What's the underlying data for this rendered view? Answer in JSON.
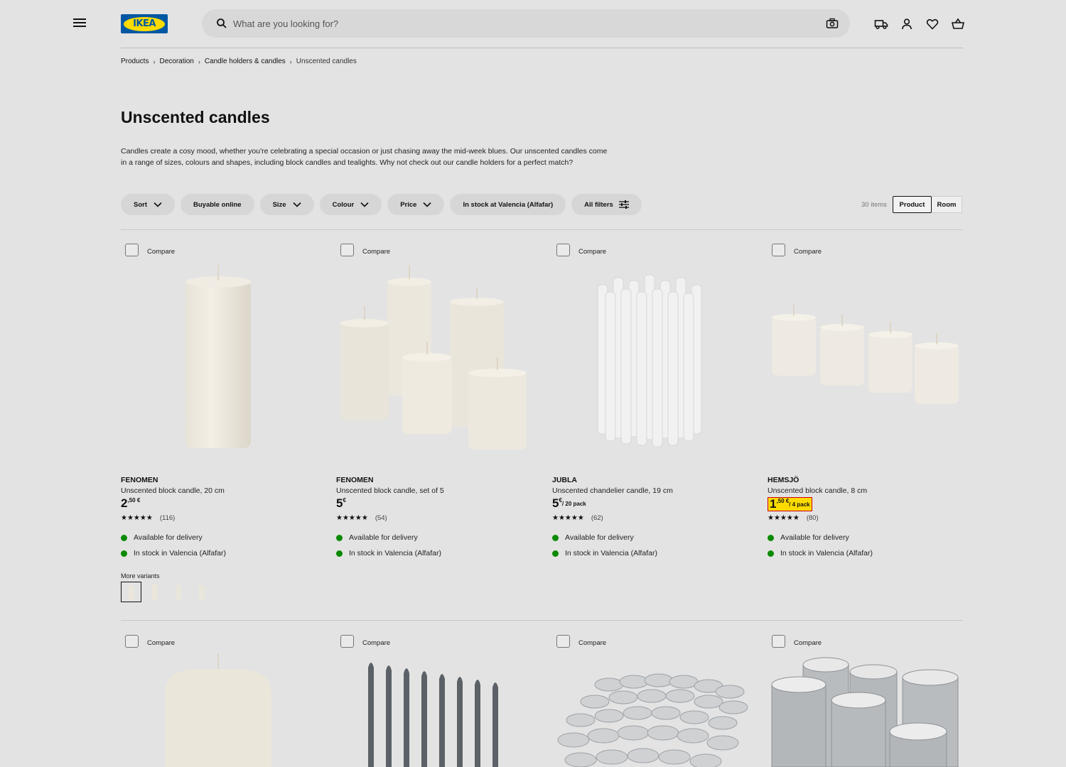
{
  "header": {
    "logo_text": "IKEA",
    "search_placeholder": "What are you looking for?",
    "icons": [
      "menu-icon",
      "search-icon",
      "camera-icon",
      "delivery-truck-icon",
      "user-icon",
      "heart-icon",
      "shopping-bag-icon"
    ]
  },
  "breadcrumb": [
    "Products",
    "Decoration",
    "Candle holders & candles",
    "Unscented candles"
  ],
  "page": {
    "title": "Unscented candles",
    "description": "Candles create a cosy mood, whether you're celebrating a special occasion or just chasing away the mid-week blues. Our unscented candles come in a range of sizes, colours and shapes, including block candles and tealights. Why not check out our candle holders for a perfect match?"
  },
  "filters": {
    "sort": "Sort",
    "buyable": "Buyable online",
    "size": "Size",
    "colour": "Colour",
    "price": "Price",
    "stock": "In stock at Valencia (Alfafar)",
    "all": "All filters"
  },
  "results": {
    "count": "30 items",
    "view_product": "Product",
    "view_room": "Room"
  },
  "compare_label": "Compare",
  "more_variants_label": "More variants",
  "stars_glyphs": "★★★★★",
  "products": [
    {
      "name": "FENOMEN",
      "desc": "Unscented block candle, 20 cm",
      "price_int": "2",
      "price_dec": ",50 €",
      "unit": "",
      "reviews": "(116)",
      "rating": 4.5,
      "delivery": "Available for delivery",
      "stock": "In stock in Valencia (Alfafar)"
    },
    {
      "name": "FENOMEN",
      "desc": "Unscented block candle, set of 5",
      "price_int": "5",
      "price_dec": "€",
      "unit": "",
      "reviews": "(54)",
      "rating": 4.5,
      "delivery": "Available for delivery",
      "stock": "In stock in Valencia (Alfafar)"
    },
    {
      "name": "JUBLA",
      "desc": "Unscented chandelier candle, 19 cm",
      "price_int": "5",
      "price_dec": "€",
      "unit": "/ 20 pack",
      "reviews": "(62)",
      "rating": 4.5,
      "delivery": "Available for delivery",
      "stock": "In stock in Valencia (Alfafar)"
    },
    {
      "name": "HEMSJÖ",
      "desc": "Unscented block candle, 8 cm",
      "price_int": "1",
      "price_dec": ",50 €",
      "unit": "/ 4 pack",
      "reviews": "(80)",
      "rating": 4.5,
      "delivery": "Available for delivery",
      "stock": "In stock in Valencia (Alfafar)"
    }
  ],
  "colors": {
    "background": "#e3e3e3",
    "stock_green": "#0a8a00",
    "price_highlight": "#ffdb00",
    "price_highlight_border": "#cc0008",
    "ikea_blue": "#0058a3"
  }
}
